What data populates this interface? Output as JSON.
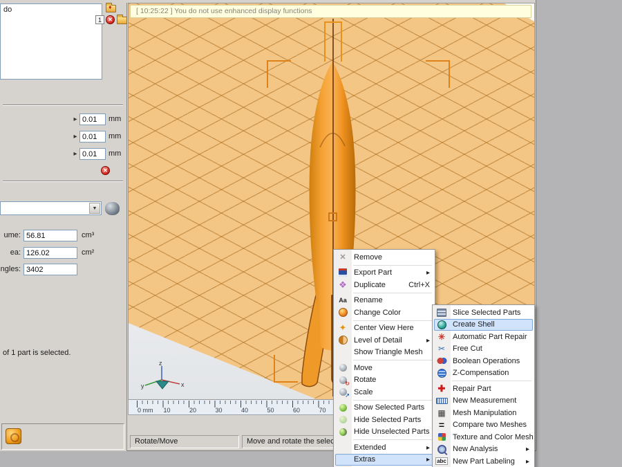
{
  "left_panel": {
    "history": {
      "visible_text": "do",
      "count": "1"
    },
    "offset_fields": [
      {
        "value": "0.01",
        "unit": "mm"
      },
      {
        "value": "0.01",
        "unit": "mm"
      },
      {
        "value": "0.01",
        "unit": "mm"
      }
    ],
    "combo_value": "",
    "stats": [
      {
        "label": "ume:",
        "value": "56.81",
        "unit": "cm³"
      },
      {
        "label": "ea:",
        "value": "126.02",
        "unit": "cm²"
      },
      {
        "label": "ngles:",
        "value": "3402",
        "unit": ""
      }
    ],
    "selection_note": "of 1 part is selected."
  },
  "viewport": {
    "info_bar": "[ 10:25:22 ] You do not use enhanced display functions",
    "axes": {
      "x": "x",
      "y": "y",
      "z": "z"
    },
    "ruler_labels": [
      "0 mm",
      "10",
      "20",
      "30",
      "40",
      "50",
      "60",
      "70"
    ]
  },
  "statusbar": {
    "mode": "Rotate/Move",
    "hint": "Move and rotate the selected parts by"
  },
  "context_menu": {
    "items": [
      {
        "label": "Remove",
        "icon": "remove-icon",
        "separator_after": true
      },
      {
        "label": "Export Part",
        "icon": "export-part-icon",
        "submenu_arrow": true
      },
      {
        "label": "Duplicate",
        "icon": "duplicate-icon",
        "shortcut": "Ctrl+X",
        "separator_after": true
      },
      {
        "label": "Rename",
        "icon": "rename-icon"
      },
      {
        "label": "Change Color",
        "icon": "change-color-icon",
        "separator_after": true
      },
      {
        "label": "Center View Here",
        "icon": "center-view-icon"
      },
      {
        "label": "Level of Detail",
        "icon": "level-of-detail-icon",
        "submenu_arrow": true
      },
      {
        "label": "Show Triangle Mesh",
        "icon": "",
        "separator_after": true
      },
      {
        "label": "Move",
        "icon": "move-icon"
      },
      {
        "label": "Rotate",
        "icon": "rotate-icon"
      },
      {
        "label": "Scale",
        "icon": "scale-icon",
        "separator_after": true
      },
      {
        "label": "Show Selected Parts",
        "icon": "show-selected-parts-icon"
      },
      {
        "label": "Hide Selected Parts",
        "icon": "hide-selected-parts-icon"
      },
      {
        "label": "Hide Unselected Parts",
        "icon": "hide-unselected-parts-icon",
        "separator_after": true
      },
      {
        "label": "Extended",
        "icon": "",
        "submenu_arrow": true
      },
      {
        "label": "Extras",
        "icon": "",
        "submenu_arrow": true,
        "highlighted": true
      }
    ]
  },
  "extras_submenu": {
    "items": [
      {
        "label": "Slice Selected Parts",
        "icon": "slice-selected-parts-icon"
      },
      {
        "label": "Create Shell",
        "icon": "create-shell-icon",
        "highlighted": true
      },
      {
        "label": "Automatic Part Repair",
        "icon": "automatic-part-repair-icon"
      },
      {
        "label": "Free Cut",
        "icon": "free-cut-icon"
      },
      {
        "label": "Boolean Operations",
        "icon": "boolean-operations-icon"
      },
      {
        "label": "Z-Compensation",
        "icon": "z-compensation-icon",
        "separator_after": true
      },
      {
        "label": "Repair Part",
        "icon": "repair-part-icon"
      },
      {
        "label": "New Measurement",
        "icon": "new-measurement-icon"
      },
      {
        "label": "Mesh Manipulation",
        "icon": "mesh-manipulation-icon"
      },
      {
        "label": "Compare two Meshes",
        "icon": "compare-two-meshes-icon"
      },
      {
        "label": "Texture and Color Mesh",
        "icon": "texture-color-mesh-icon"
      },
      {
        "label": "New Analysis",
        "icon": "new-analysis-icon",
        "submenu_arrow": true
      },
      {
        "label": "New Part Labeling",
        "icon": "new-part-labeling-icon",
        "submenu_arrow": true
      }
    ]
  },
  "colors": {
    "platform": "#f4c685",
    "grid_line": "#b07428",
    "rocket": "#f09a24",
    "selection_bracket": "#e0821a",
    "menu_highlight": "#d1e3fb",
    "info_bar_bg": "#ffffdf"
  }
}
